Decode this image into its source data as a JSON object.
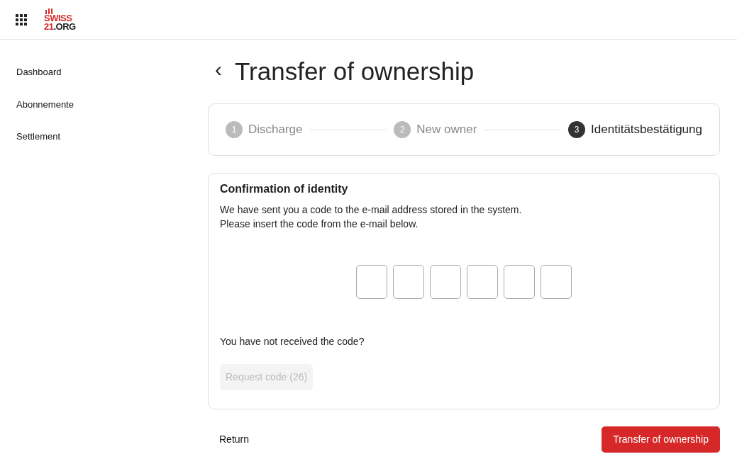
{
  "header": {
    "logo": {
      "line1": "SWISS",
      "line2_accent": "21",
      "line2_rest": ".ORG"
    }
  },
  "sidebar": {
    "items": [
      {
        "label": "Dashboard",
        "selected": false
      },
      {
        "label": "Abonnemente",
        "selected": false
      },
      {
        "label": "Settlement",
        "selected": false
      }
    ]
  },
  "page": {
    "back_icon": "‹",
    "title": "Transfer of ownership"
  },
  "steps": [
    {
      "number": "1",
      "label": "Discharge",
      "selected": false
    },
    {
      "number": "2",
      "label": "New owner",
      "selected": false
    },
    {
      "number": "3",
      "label": "Identitätsbestätigung",
      "selected": true
    }
  ],
  "confirmation": {
    "heading": "Confirmation of identity",
    "text_lines": [
      "We have sent you a code to the e-mail address stored in the system.",
      "Please insert the code from the e-mail below."
    ],
    "code_fields": [
      {
        "filled": false
      },
      {
        "filled": false
      },
      {
        "filled": false
      },
      {
        "filled": false
      },
      {
        "filled": false
      },
      {
        "filled": false
      }
    ],
    "not_received": "You have not received the code?",
    "request_button": {
      "label": "Request code (26)",
      "disabled": true
    }
  },
  "footer": {
    "return_button": "Return",
    "submit_button": "Transfer of ownership"
  }
}
